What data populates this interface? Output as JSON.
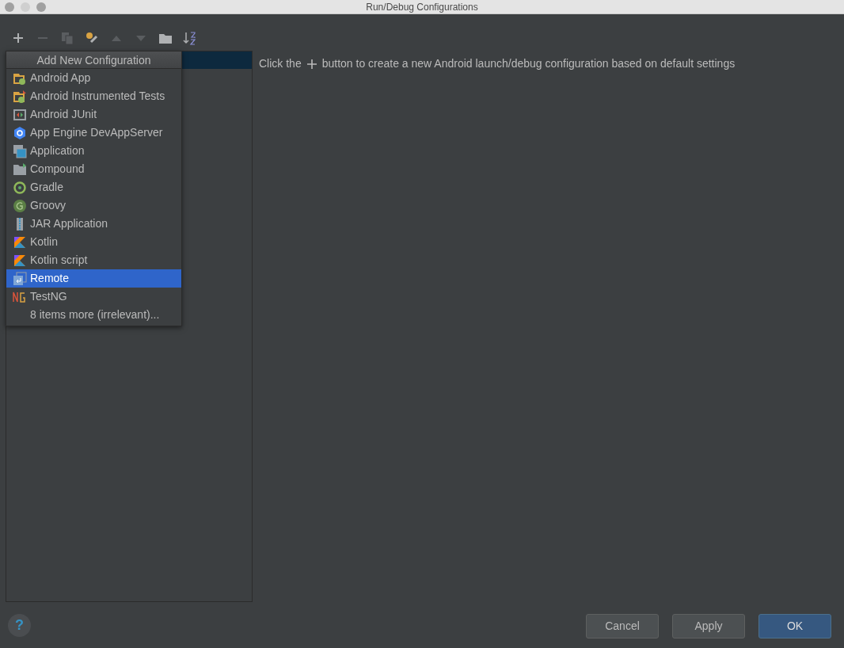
{
  "window": {
    "title": "Run/Debug Configurations"
  },
  "toolbar": [
    {
      "kind": "add",
      "disabled": false
    },
    {
      "kind": "remove",
      "disabled": true
    },
    {
      "kind": "copy",
      "disabled": true
    },
    {
      "kind": "edit-defaults",
      "disabled": false
    },
    {
      "kind": "up",
      "disabled": true
    },
    {
      "kind": "down",
      "disabled": true
    },
    {
      "kind": "folder",
      "disabled": false
    },
    {
      "kind": "sort",
      "disabled": false
    }
  ],
  "popup": {
    "title": "Add New Configuration",
    "items": [
      {
        "label": "Android App",
        "kind": "android-app",
        "selected": false
      },
      {
        "label": "Android Instrumented Tests",
        "kind": "android-tests",
        "selected": false
      },
      {
        "label": "Android JUnit",
        "kind": "junit",
        "selected": false
      },
      {
        "label": "App Engine DevAppServer",
        "kind": "app-engine",
        "selected": false
      },
      {
        "label": "Application",
        "kind": "application",
        "selected": false
      },
      {
        "label": "Compound",
        "kind": "compound",
        "selected": false
      },
      {
        "label": "Gradle",
        "kind": "gradle",
        "selected": false
      },
      {
        "label": "Groovy",
        "kind": "groovy",
        "selected": false
      },
      {
        "label": "JAR Application",
        "kind": "jar",
        "selected": false
      },
      {
        "label": "Kotlin",
        "kind": "kotlin",
        "selected": false
      },
      {
        "label": "Kotlin script",
        "kind": "kotlin",
        "selected": false
      },
      {
        "label": "Remote",
        "kind": "remote",
        "selected": true
      },
      {
        "label": "TestNG",
        "kind": "testng",
        "selected": false
      },
      {
        "label": "8 items more (irrelevant)...",
        "kind": "more",
        "selected": false
      }
    ]
  },
  "hint": {
    "before": "Click the",
    "after": "button to create a new Android launch/debug configuration based on default settings"
  },
  "help_button": "?",
  "buttons": [
    {
      "label": "Cancel",
      "default": false
    },
    {
      "label": "Apply",
      "default": false
    },
    {
      "label": "OK",
      "default": true
    }
  ]
}
